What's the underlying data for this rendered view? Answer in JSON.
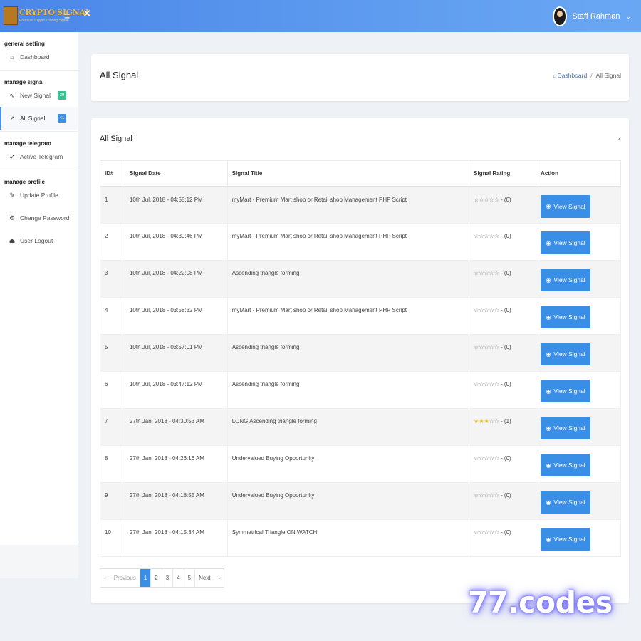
{
  "app": {
    "logo_title": "CRYPTO SIGNAL",
    "logo_subtitle": "Premium Crypto Trading Signal",
    "user_name": "Staff Rahman"
  },
  "sidebar": {
    "sections": [
      {
        "title": "general setting",
        "items": [
          {
            "label": "Dashboard",
            "icon": "home-icon"
          }
        ]
      },
      {
        "title": "manage signal",
        "items": [
          {
            "label": "New Signal",
            "icon": "pulse-icon",
            "badge": "29",
            "badge_color": "#34c38f"
          },
          {
            "label": "All Signal",
            "icon": "chart-line-icon",
            "badge": "41",
            "badge_color": "#3a8ee6",
            "active": true
          }
        ]
      },
      {
        "title": "manage telegram",
        "items": [
          {
            "label": "Active Telegram",
            "icon": "send-icon"
          }
        ]
      },
      {
        "title": "manage profile",
        "items": [
          {
            "label": "Update Profile",
            "icon": "edit-icon"
          },
          {
            "label": "Change Password",
            "icon": "gear-icon"
          },
          {
            "label": "User Logout",
            "icon": "logout-icon"
          }
        ]
      }
    ]
  },
  "page": {
    "title": "All Signal",
    "breadcrumb_home": "Dashboard",
    "breadcrumb_current": "All Signal"
  },
  "card": {
    "title": "All Signal"
  },
  "table": {
    "columns": [
      "ID#",
      "Signal Date",
      "Signal Title",
      "Signal Rating",
      "Action"
    ],
    "action_label": "View Signal",
    "rows": [
      {
        "id": "1",
        "date": "10th Jul, 2018 - 04:58:12 PM",
        "title": "myMart - Premium Mart shop or Retail shop Management PHP Script",
        "stars": 0,
        "rating": "- (0)"
      },
      {
        "id": "2",
        "date": "10th Jul, 2018 - 04:30:46 PM",
        "title": "myMart - Premium Mart shop or Retail shop Management PHP Script",
        "stars": 0,
        "rating": "- (0)"
      },
      {
        "id": "3",
        "date": "10th Jul, 2018 - 04:22:08 PM",
        "title": "Ascending triangle forming",
        "stars": 0,
        "rating": "- (0)"
      },
      {
        "id": "4",
        "date": "10th Jul, 2018 - 03:58:32 PM",
        "title": "myMart - Premium Mart shop or Retail shop Management PHP Script",
        "stars": 0,
        "rating": "- (0)"
      },
      {
        "id": "5",
        "date": "10th Jul, 2018 - 03:57:01 PM",
        "title": "Ascending triangle forming",
        "stars": 0,
        "rating": "- (0)"
      },
      {
        "id": "6",
        "date": "10th Jul, 2018 - 03:47:12 PM",
        "title": "Ascending triangle forming",
        "stars": 0,
        "rating": "- (0)"
      },
      {
        "id": "7",
        "date": "27th Jan, 2018 - 04:30:53 AM",
        "title": "LONG Ascending triangle forming",
        "stars": 3,
        "rating": "- (1)"
      },
      {
        "id": "8",
        "date": "27th Jan, 2018 - 04:26:16 AM",
        "title": "Undervalued Buying Opportunity",
        "stars": 0,
        "rating": "- (0)"
      },
      {
        "id": "9",
        "date": "27th Jan, 2018 - 04:18:55 AM",
        "title": "Undervalued Buying Opportunity",
        "stars": 0,
        "rating": "- (0)"
      },
      {
        "id": "10",
        "date": "27th Jan, 2018 - 04:15:34 AM",
        "title": "Symmetrical Triangle ON WATCH",
        "stars": 0,
        "rating": "- (0)"
      }
    ]
  },
  "pagination": {
    "previous": "Previous",
    "next": "Next",
    "pages": [
      "1",
      "2",
      "3",
      "4",
      "5"
    ],
    "current": "1"
  },
  "watermark": "77.codes",
  "colors": {
    "topbar": "#4a86e8",
    "primary": "#3a8ee6",
    "star_filled": "#f3b61f"
  }
}
